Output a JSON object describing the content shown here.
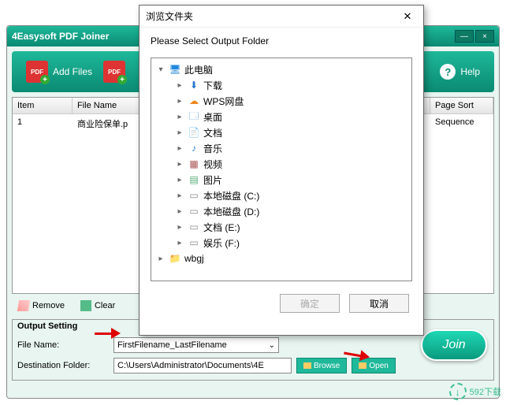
{
  "app": {
    "title": "4Easysoft PDF Joiner"
  },
  "toolbar": {
    "add_files": "Add Files",
    "help": "Help"
  },
  "table": {
    "headers": {
      "item": "Item",
      "filename": "File Name",
      "pagesort": "Page Sort"
    },
    "rows": [
      {
        "item": "1",
        "filename": "商业险保单.p",
        "pagesort": "Sequence"
      }
    ]
  },
  "actions": {
    "remove": "Remove",
    "clear": "Clear"
  },
  "output": {
    "section_title": "Output Setting",
    "filename_label": "File Name:",
    "filename_value": "FirstFilename_LastFilename",
    "destfolder_label": "Destination Folder:",
    "destfolder_value": "C:\\Users\\Administrator\\Documents\\4E",
    "browse": "Browse",
    "open": "Open",
    "join": "Join"
  },
  "dialog": {
    "title": "浏览文件夹",
    "instruction": "Please Select Output Folder",
    "tree": [
      {
        "depth": 1,
        "expand": "▾",
        "icon": "pc",
        "label": "此电脑"
      },
      {
        "depth": 2,
        "expand": "▸",
        "icon": "dl",
        "label": "下载"
      },
      {
        "depth": 2,
        "expand": "▸",
        "icon": "cloud",
        "label": "WPS网盘"
      },
      {
        "depth": 2,
        "expand": "▸",
        "icon": "desk",
        "label": "桌面"
      },
      {
        "depth": 2,
        "expand": "▸",
        "icon": "doc",
        "label": "文档"
      },
      {
        "depth": 2,
        "expand": "▸",
        "icon": "music",
        "label": "音乐"
      },
      {
        "depth": 2,
        "expand": "▸",
        "icon": "video",
        "label": "视频"
      },
      {
        "depth": 2,
        "expand": "▸",
        "icon": "pic",
        "label": "图片"
      },
      {
        "depth": 2,
        "expand": "▸",
        "icon": "disk",
        "label": "本地磁盘 (C:)"
      },
      {
        "depth": 2,
        "expand": "▸",
        "icon": "disk",
        "label": "本地磁盘 (D:)"
      },
      {
        "depth": 2,
        "expand": "▸",
        "icon": "disk",
        "label": "文档 (E:)"
      },
      {
        "depth": 2,
        "expand": "▸",
        "icon": "disk",
        "label": "娱乐 (F:)"
      },
      {
        "depth": 1,
        "expand": "▸",
        "icon": "folder",
        "label": "wbgj"
      }
    ],
    "ok": "确定",
    "cancel": "取消"
  },
  "watermark": {
    "text": "592下载"
  }
}
